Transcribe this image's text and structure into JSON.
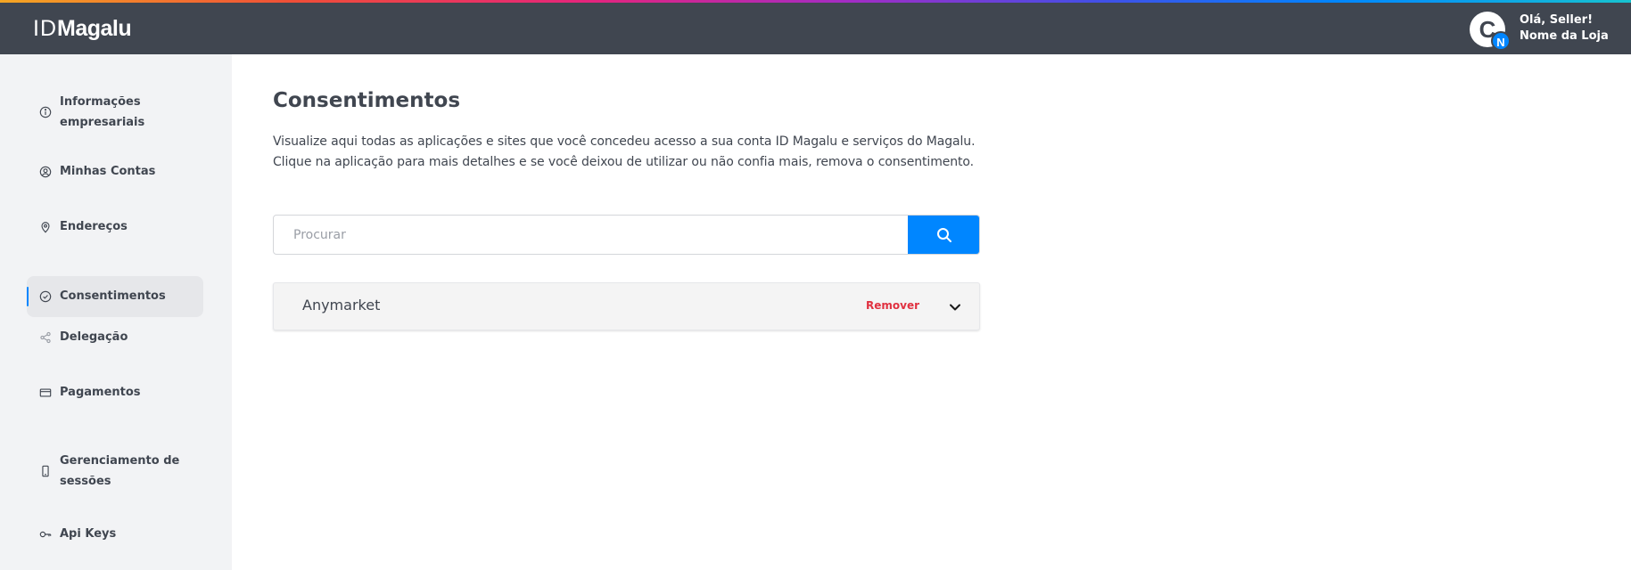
{
  "header": {
    "logo_id": "ID",
    "logo_brand": "Magalu",
    "avatar_letter": "C",
    "avatar_badge": "N",
    "greeting": "Olá, Seller!",
    "store_name": "Nome da Loja"
  },
  "sidebar": {
    "items": [
      {
        "label_line1": "Informações",
        "label_line2": "empresariais",
        "icon": "info-icon"
      },
      {
        "label": "Minhas Contas",
        "icon": "user-circle-icon"
      },
      {
        "label": "Endereços",
        "icon": "map-pin-icon"
      },
      {
        "label": "Consentimentos",
        "icon": "check-circle-icon",
        "active": true
      },
      {
        "label": "Delegação",
        "icon": "share-icon"
      },
      {
        "label": "Pagamentos",
        "icon": "credit-card-icon"
      },
      {
        "label_line1": "Gerenciamento de",
        "label_line2": "sessões",
        "icon": "mobile-icon"
      },
      {
        "label": "Api Keys",
        "icon": "key-icon"
      }
    ]
  },
  "main": {
    "title": "Consentimentos",
    "description_line1": "Visualize aqui todas as aplicações e sites que você concedeu acesso a sua conta ID Magalu e serviços do Magalu.",
    "description_line2": "Clique na aplicação para mais detalhes e se você deixou de utilizar ou não confia mais, remova o consentimento.",
    "search": {
      "placeholder": "Procurar",
      "value": ""
    },
    "consents": [
      {
        "name": "Anymarket",
        "remove_label": "Remover"
      }
    ]
  },
  "colors": {
    "header_bg": "#404650",
    "sidebar_bg": "#f2f3f5",
    "accent": "#0086ff",
    "danger": "#e03140"
  }
}
